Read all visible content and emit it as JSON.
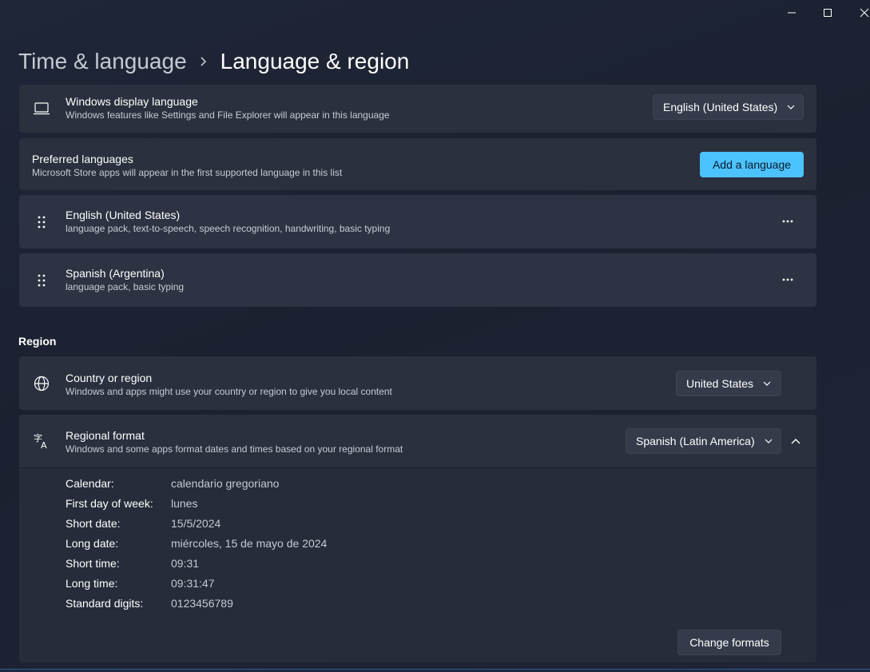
{
  "window": {
    "controls": {
      "minimize": "minimize-icon",
      "maximize": "maximize-icon",
      "close": "close-icon"
    }
  },
  "breadcrumb": {
    "parent": "Time & language",
    "current": "Language & region"
  },
  "display_language": {
    "icon": "laptop-icon",
    "title": "Windows display language",
    "subtitle": "Windows features like Settings and File Explorer will appear in this language",
    "value": "English (United States)"
  },
  "preferred_languages": {
    "title": "Preferred languages",
    "subtitle": "Microsoft Store apps will appear in the first supported language in this list",
    "add_button": "Add a language",
    "items": [
      {
        "name": "English (United States)",
        "features": "language pack, text-to-speech, speech recognition, handwriting, basic typing"
      },
      {
        "name": "Spanish (Argentina)",
        "features": "language pack, basic typing"
      }
    ]
  },
  "region": {
    "header": "Region",
    "country": {
      "icon": "globe-icon",
      "title": "Country or region",
      "subtitle": "Windows and apps might use your country or region to give you local content",
      "value": "United States"
    },
    "format": {
      "icon": "language-format-icon",
      "title": "Regional format",
      "subtitle": "Windows and some apps format dates and times based on your regional format",
      "value": "Spanish (Latin America)",
      "details": [
        {
          "label": "Calendar:",
          "value": "calendario gregoriano"
        },
        {
          "label": "First day of week:",
          "value": "lunes"
        },
        {
          "label": "Short date:",
          "value": "15/5/2024"
        },
        {
          "label": "Long date:",
          "value": "miércoles, 15 de mayo de 2024"
        },
        {
          "label": "Short time:",
          "value": "09:31"
        },
        {
          "label": "Long time:",
          "value": "09:31:47"
        },
        {
          "label": "Standard digits:",
          "value": "0123456789"
        }
      ],
      "change_button": "Change formats"
    }
  },
  "colors": {
    "accent": "#4cc2ff",
    "card": "#2a303e",
    "background": "#1c2230"
  }
}
